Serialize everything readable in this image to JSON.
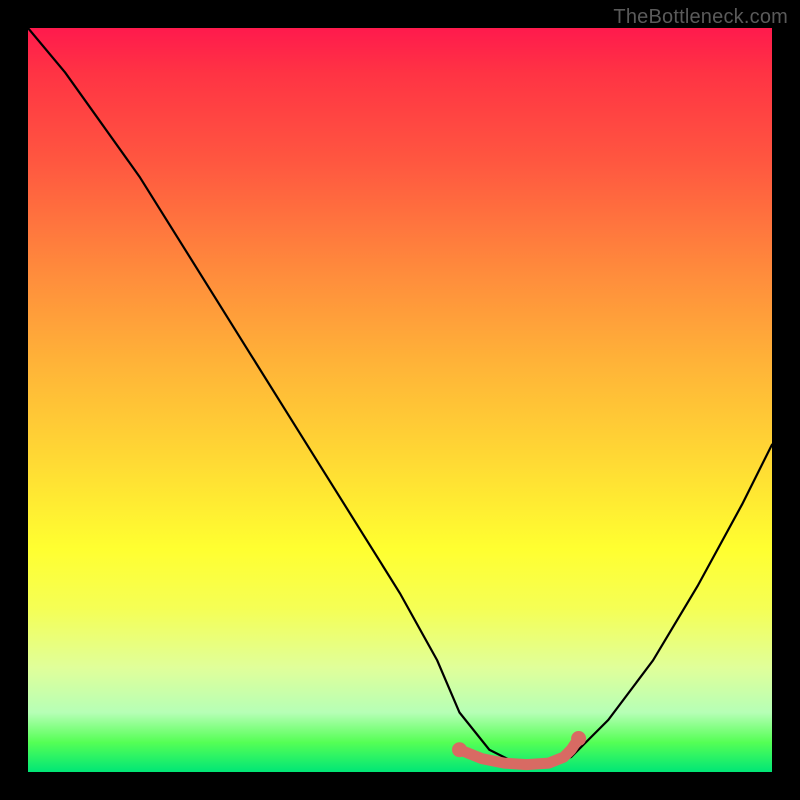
{
  "watermark": "TheBottleneck.com",
  "colors": {
    "frame": "#000000",
    "curve": "#000000",
    "marker_fill": "#d86a63",
    "marker_stroke": "#b44a44"
  },
  "chart_data": {
    "type": "line",
    "title": "",
    "xlabel": "",
    "ylabel": "",
    "xlim": [
      0,
      100
    ],
    "ylim": [
      0,
      100
    ],
    "grid": false,
    "series": [
      {
        "name": "bottleneck-curve",
        "x": [
          0,
          5,
          10,
          15,
          20,
          25,
          30,
          35,
          40,
          45,
          50,
          55,
          58,
          62,
          66,
          70,
          73,
          78,
          84,
          90,
          96,
          100
        ],
        "y": [
          100,
          94,
          87,
          80,
          72,
          64,
          56,
          48,
          40,
          32,
          24,
          15,
          8,
          3,
          1,
          1,
          2,
          7,
          15,
          25,
          36,
          44
        ]
      }
    ],
    "markers": {
      "name": "optimal-range",
      "x": [
        58,
        61,
        64,
        67,
        70,
        72,
        73,
        74
      ],
      "y": [
        3.0,
        1.8,
        1.2,
        1.0,
        1.2,
        2.0,
        3.0,
        4.5
      ]
    }
  }
}
